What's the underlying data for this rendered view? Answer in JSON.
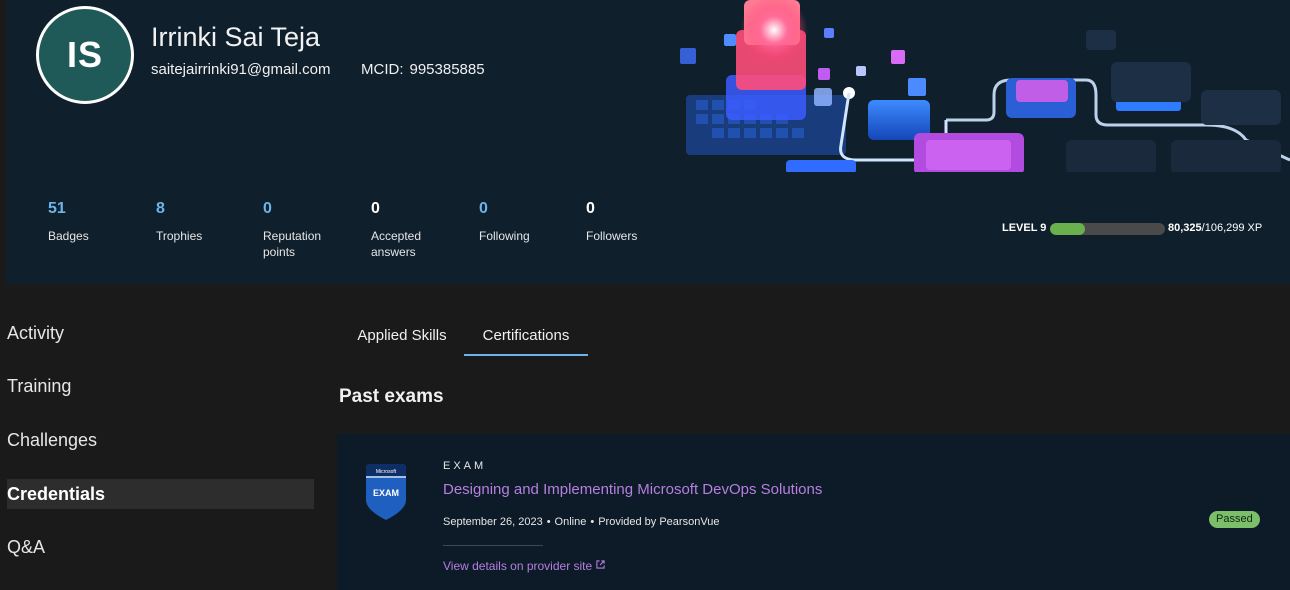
{
  "profile": {
    "initials": "IS",
    "name": "Irrinki Sai Teja",
    "email": "saitejairrinki91@gmail.com",
    "mcid_label": "MCID:",
    "mcid": "995385885"
  },
  "stats": [
    {
      "value": "51",
      "label": "Badges"
    },
    {
      "value": "8",
      "label": "Trophies"
    },
    {
      "value": "0",
      "label": "Reputation points"
    },
    {
      "value": "0",
      "label": "Accepted answers"
    },
    {
      "value": "0",
      "label": "Following"
    },
    {
      "value": "0",
      "label": "Followers"
    }
  ],
  "level": {
    "label": "LEVEL 9",
    "xp_current": "80,325",
    "xp_total": "/106,299 XP",
    "progress": 0.3
  },
  "sidebar": {
    "items": [
      {
        "label": "Activity"
      },
      {
        "label": "Training"
      },
      {
        "label": "Challenges"
      },
      {
        "label": "Credentials",
        "active": true
      },
      {
        "label": "Q&A"
      }
    ]
  },
  "tabs": [
    {
      "label": "Applied Skills"
    },
    {
      "label": "Certifications",
      "active": true
    }
  ],
  "section_title": "Past exams",
  "exam": {
    "badge_top_text": "Microsoft",
    "badge_text": "EXAM",
    "eyebrow": "EXAM",
    "title": "Designing and Implementing Microsoft DevOps Solutions",
    "date": "September 26, 2023",
    "mode": "Online",
    "provider": "Provided by PearsonVue",
    "link_label": "View details on provider site",
    "status": "Passed"
  },
  "colors": {
    "accent_blue": "#6cb4ea",
    "link_purple": "#b67fe0",
    "passed_green": "#7cbf6a"
  }
}
